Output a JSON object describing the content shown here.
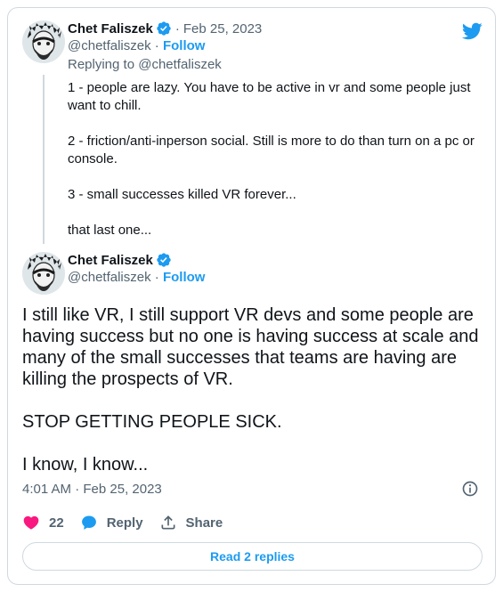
{
  "reply_tweet": {
    "author_name": "Chet Faliszek",
    "handle": "@chetfaliszek",
    "separator": "·",
    "date": "Feb 25, 2023",
    "follow_label": "Follow",
    "replying_to": "Replying to @chetfaliszek",
    "paragraphs": [
      "1 - people are lazy. You have to be active in vr and some people just\nwant to chill.",
      "2 - friction/anti-inperson social. Still is more to do than turn on a pc or\nconsole.",
      "3 - small successes killed VR forever...",
      "that last one..."
    ]
  },
  "main_tweet": {
    "author_name": "Chet Faliszek",
    "handle": "@chetfaliszek",
    "separator": "·",
    "follow_label": "Follow",
    "paragraphs": [
      "I still like VR, I still support VR devs and some people are having success but no one is having success at scale and many of the small successes that teams are having are killing the prospects of VR.",
      "STOP GETTING PEOPLE SICK.",
      "I know, I know..."
    ],
    "timestamp": "4:01 AM · Feb 25, 2023"
  },
  "actions": {
    "like_count": "22",
    "reply_label": "Reply",
    "share_label": "Share"
  },
  "read_replies_label": "Read 2 replies",
  "colors": {
    "accent": "#1d9bf0",
    "like": "#f91880",
    "text": "#0f1419",
    "muted": "#536471",
    "border": "#cfd9de"
  },
  "icons": [
    "twitter-logo-icon",
    "verified-badge-icon",
    "info-icon",
    "heart-icon",
    "reply-bubble-icon",
    "share-icon"
  ]
}
